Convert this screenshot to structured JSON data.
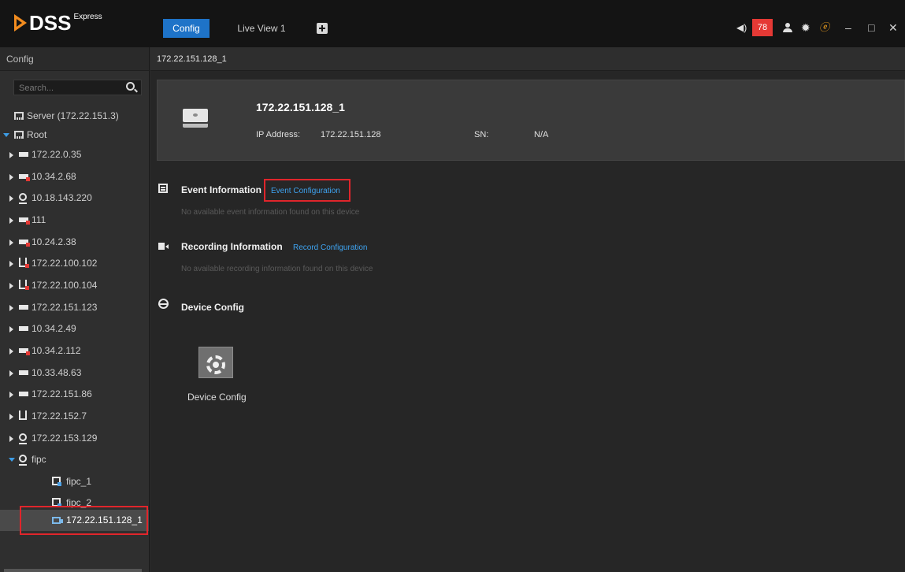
{
  "app": {
    "logo_text": "DSS",
    "logo_sup": "Express",
    "colors": {
      "accent": "#1e73c8",
      "alarm": "#e53935",
      "link": "#3ea3f0",
      "highlight": "#e0252b"
    }
  },
  "tabs": [
    {
      "label": "Config",
      "active": true
    },
    {
      "label": "Live View 1",
      "active": false
    }
  ],
  "system": {
    "alarm_count": "78",
    "icons": [
      "volume-icon",
      "user-icon",
      "gear-icon",
      "gauge-icon"
    ]
  },
  "sidebar": {
    "title": "Config",
    "search_placeholder": "Search...",
    "tree": [
      {
        "label": "Server (172.22.151.3)",
        "icon": "server-icon"
      },
      {
        "label": "Root",
        "icon": "server-icon"
      },
      {
        "label": "172.22.0.35",
        "icon": "device-icon"
      },
      {
        "label": "10.34.2.68",
        "icon": "device-offline-icon"
      },
      {
        "label": "10.18.143.220",
        "icon": "camera-icon"
      },
      {
        "label": "111",
        "icon": "device-offline-icon"
      },
      {
        "label": "10.24.2.38",
        "icon": "device-offline-icon"
      },
      {
        "label": "172.22.100.102",
        "icon": "nvr-offline-icon"
      },
      {
        "label": "172.22.100.104",
        "icon": "nvr-offline-icon"
      },
      {
        "label": "172.22.151.123",
        "icon": "device-icon"
      },
      {
        "label": "10.34.2.49",
        "icon": "device-icon"
      },
      {
        "label": "10.34.2.112",
        "icon": "device-offline-icon"
      },
      {
        "label": "10.33.48.63",
        "icon": "device-icon"
      },
      {
        "label": "172.22.151.86",
        "icon": "device-icon"
      },
      {
        "label": "172.22.152.7",
        "icon": "nvr-icon"
      },
      {
        "label": "172.22.153.129",
        "icon": "camera-icon"
      },
      {
        "label": "fipc",
        "icon": "camera-icon"
      },
      {
        "label": "fipc_1",
        "icon": "channel-icon"
      },
      {
        "label": "fipc_2",
        "icon": "channel-icon"
      },
      {
        "label": "172.22.151.128_1",
        "icon": "video-channel-icon"
      }
    ]
  },
  "main": {
    "breadcrumb": "172.22.151.128_1",
    "device": {
      "name": "172.22.151.128_1",
      "ip_label": "IP Address:",
      "ip": "172.22.151.128",
      "sn_label": "SN:",
      "sn": "N/A"
    },
    "event": {
      "title": "Event Information",
      "link": "Event Configuration",
      "note": "No available event information found on this device"
    },
    "recording": {
      "title": "Recording Information",
      "link": "Record Configuration",
      "note": "No available recording information found on this device"
    },
    "device_config": {
      "title": "Device Config",
      "tile_label": "Device Config"
    }
  }
}
